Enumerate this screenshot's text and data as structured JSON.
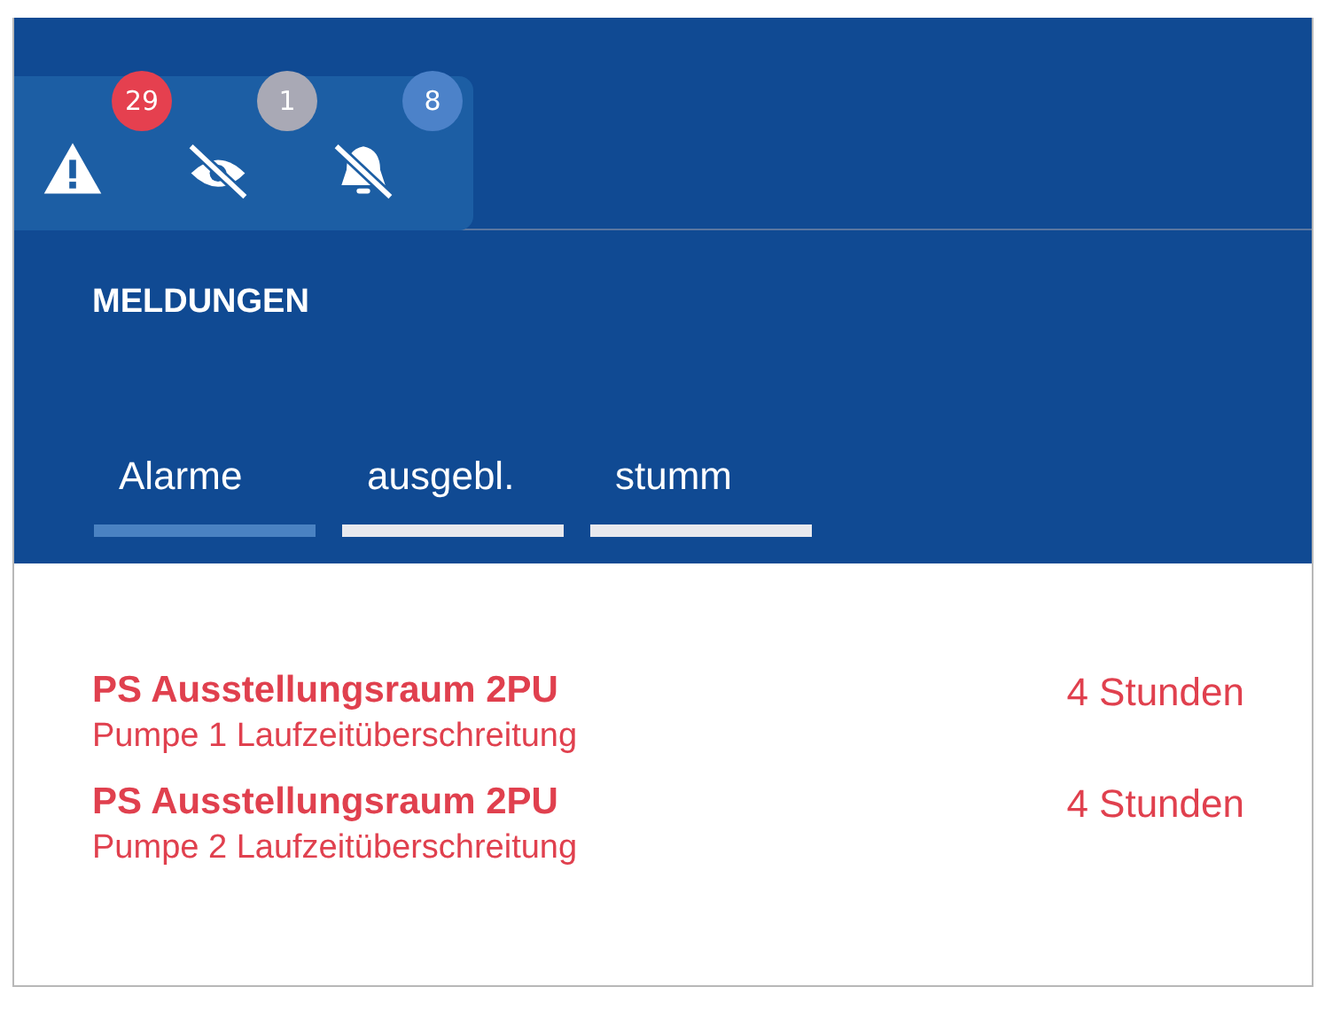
{
  "status_icons": [
    {
      "kind": "warning",
      "count": "29",
      "color": "#e5404f"
    },
    {
      "kind": "hidden",
      "count": "1",
      "color": "#a9a9b5"
    },
    {
      "kind": "muted",
      "count": "8",
      "color": "#4c82c9"
    }
  ],
  "section_title": "MELDUNGEN",
  "tabs": [
    {
      "label": "Alarme",
      "selected": true
    },
    {
      "label": "ausgebl.",
      "selected": false
    },
    {
      "label": "stumm",
      "selected": false
    }
  ],
  "alarms": [
    {
      "source": "PS Ausstellungsraum 2PU",
      "message": "Pumpe 1 Laufzeitüberschreitung",
      "age": "4 Stunden"
    },
    {
      "source": "PS Ausstellungsraum 2PU",
      "message": "Pumpe 2 Laufzeitüberschreitung",
      "age": "4 Stunden"
    }
  ]
}
